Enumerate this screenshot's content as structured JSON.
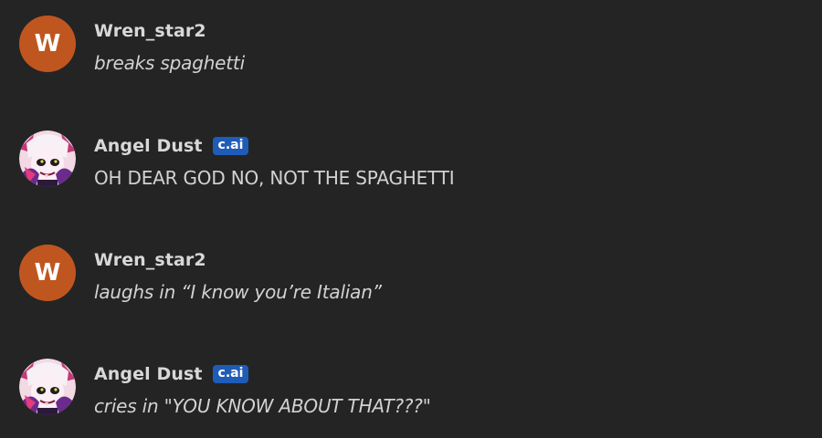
{
  "messages": [
    {
      "author": "Wren_star2",
      "avatar_letter": "W",
      "avatar_color": "#c0561f",
      "is_character": false,
      "text": "breaks spaghetti",
      "italic": true
    },
    {
      "author": "Angel Dust",
      "badge": "c.ai",
      "is_character": true,
      "text": "OH DEAR GOD NO, NOT THE SPAGHETTI",
      "italic": false
    },
    {
      "author": "Wren_star2",
      "avatar_letter": "W",
      "avatar_color": "#c0561f",
      "is_character": false,
      "text": "laughs in “I know you’re Italian”",
      "italic": true
    },
    {
      "author": "Angel Dust",
      "badge": "c.ai",
      "is_character": true,
      "text": "cries in \"YOU KNOW ABOUT THAT???\"",
      "italic": true
    }
  ],
  "colors": {
    "background": "#242424",
    "badge": "#1f5cb8",
    "user_avatar": "#c0561f"
  }
}
